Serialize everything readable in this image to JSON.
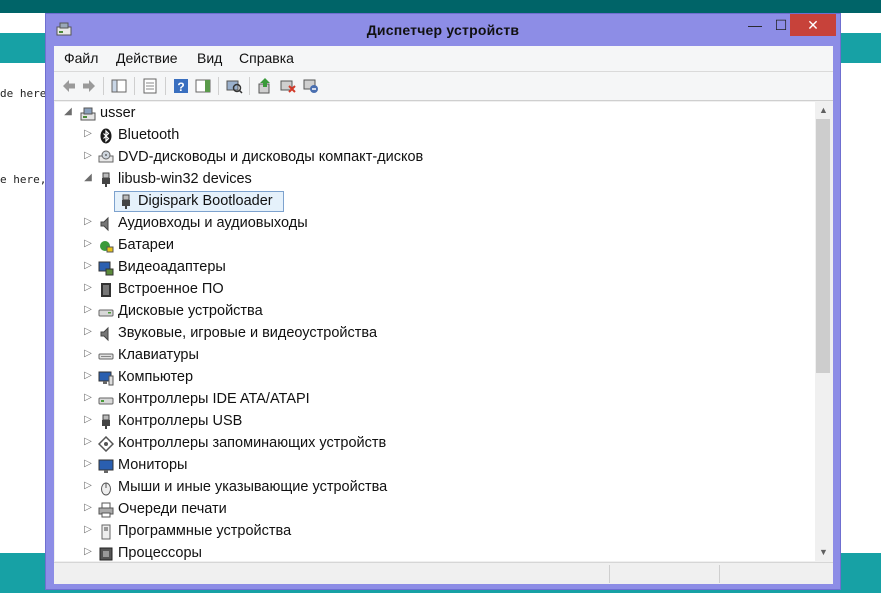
{
  "background": {
    "code_lines": [
      "de here,",
      "e here,"
    ],
    "colors": {
      "teal_dark": "#006468",
      "teal": "#17a1a5"
    }
  },
  "window": {
    "title": "Диспетчер устройств",
    "buttons": {
      "minimize": "—",
      "maximize": "☐",
      "close": "✕"
    },
    "accent": "#8d8de6",
    "close_color": "#c7423a"
  },
  "menu": [
    "Файл",
    "Действие",
    "Вид",
    "Справка"
  ],
  "toolbar": [
    "back-icon",
    "forward-icon",
    "show-hide-console-tree-icon",
    "properties-icon",
    "help-icon",
    "action-pane-icon",
    "scan-hardware-icon",
    "update-driver-icon",
    "disable-device-icon",
    "uninstall-device-icon"
  ],
  "tree": {
    "root": {
      "label": "usser",
      "icon": "computer-icon"
    },
    "items": [
      {
        "label": "Bluetooth",
        "icon": "bluetooth-icon",
        "expanded": false
      },
      {
        "label": "DVD-дисководы и дисководы компакт-дисков",
        "icon": "dvd-drive-icon",
        "expanded": false
      },
      {
        "label": "libusb-win32 devices",
        "icon": "usb-plug-icon",
        "expanded": true,
        "children": [
          {
            "label": "Digispark Bootloader",
            "icon": "usb-plug-icon",
            "selected": true
          }
        ]
      },
      {
        "label": "Аудиовходы и аудиовыходы",
        "icon": "speaker-icon",
        "expanded": false
      },
      {
        "label": "Батареи",
        "icon": "battery-icon",
        "expanded": false
      },
      {
        "label": "Видеоадаптеры",
        "icon": "display-adapter-icon",
        "expanded": false
      },
      {
        "label": "Встроенное ПО",
        "icon": "firmware-icon",
        "expanded": false
      },
      {
        "label": "Дисковые устройства",
        "icon": "disk-drive-icon",
        "expanded": false
      },
      {
        "label": "Звуковые, игровые и видеоустройства",
        "icon": "speaker-icon",
        "expanded": false
      },
      {
        "label": "Клавиатуры",
        "icon": "keyboard-icon",
        "expanded": false
      },
      {
        "label": "Компьютер",
        "icon": "computer-monitor-icon",
        "expanded": false
      },
      {
        "label": "Контроллеры IDE ATA/ATAPI",
        "icon": "ide-controller-icon",
        "expanded": false
      },
      {
        "label": "Контроллеры USB",
        "icon": "usb-plug-icon",
        "expanded": false
      },
      {
        "label": "Контроллеры запоминающих устройств",
        "icon": "storage-controller-icon",
        "expanded": false
      },
      {
        "label": "Мониторы",
        "icon": "monitor-icon",
        "expanded": false
      },
      {
        "label": "Мыши и иные указывающие устройства",
        "icon": "mouse-icon",
        "expanded": false
      },
      {
        "label": "Очереди печати",
        "icon": "printer-icon",
        "expanded": false
      },
      {
        "label": "Программные устройства",
        "icon": "software-device-icon",
        "expanded": false
      },
      {
        "label": "Процессоры",
        "icon": "processor-icon",
        "expanded": false
      }
    ]
  },
  "status_bar": [
    "",
    "",
    ""
  ]
}
